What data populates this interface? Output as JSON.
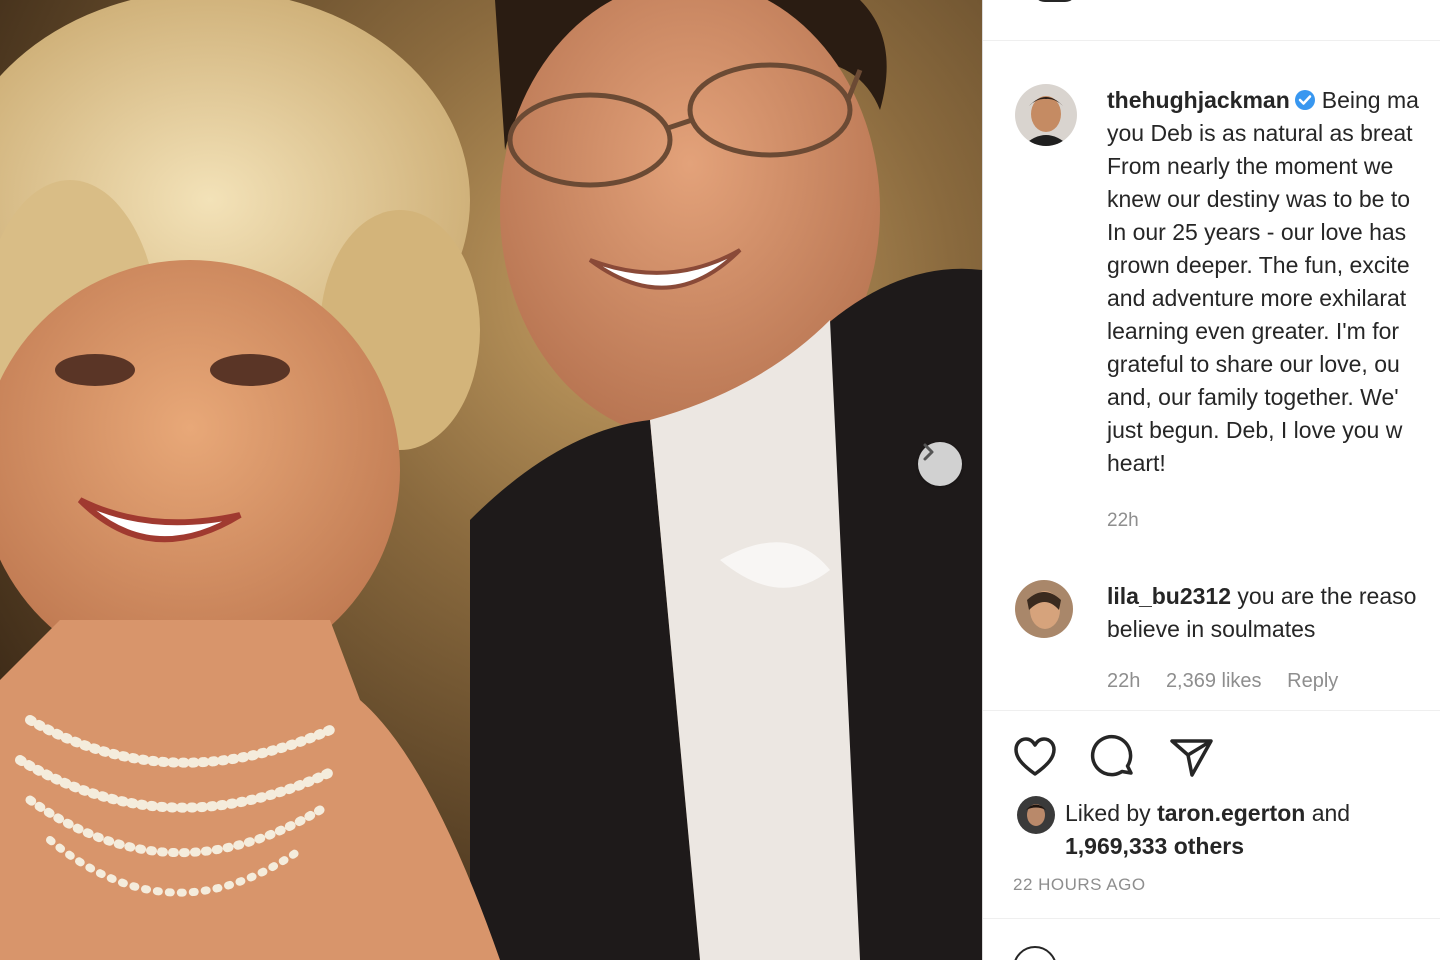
{
  "post": {
    "username": "thehughjackman",
    "verified": true,
    "caption": "Being ma\nyou Deb is as natural as breat\nFrom nearly the moment we\nknew our destiny was to be to\nIn our 25 years - our love has\ngrown deeper. The fun, excite\nand adventure more exhilarat\nlearning even greater. I'm for\ngrateful to share our love, ou\nand, our family together. We'\njust begun. Deb, I love you w\nheart!",
    "time": "22h"
  },
  "comment": {
    "username": "lila_bu2312",
    "text": "you are the reaso\nbelieve in soulmates",
    "time": "22h",
    "likes": "2,369 likes",
    "reply": "Reply"
  },
  "likes": {
    "prefix": "Liked by",
    "user": "taron.egerton",
    "and": "and",
    "count": "1,969,333 others"
  },
  "timestamp": "22 HOURS AGO",
  "icons": {
    "like": "heart-icon",
    "comment": "comment-icon",
    "share": "paper-plane-icon",
    "next": "chevron-right-icon",
    "verified": "verified-badge-icon"
  },
  "colors": {
    "verified": "#3897f0",
    "text": "#262626",
    "muted": "#8e8e8e"
  }
}
